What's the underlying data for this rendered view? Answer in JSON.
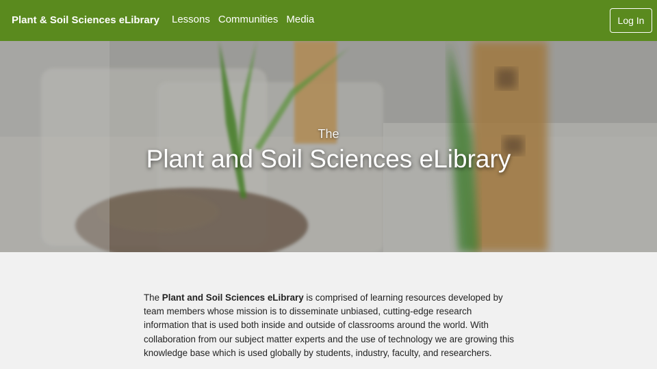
{
  "nav": {
    "brand": "Plant & Soil Sciences eLibrary",
    "links": [
      "Lessons",
      "Communities",
      "Media"
    ],
    "login_label": "Log In"
  },
  "hero": {
    "pretitle": "The",
    "title": "Plant and Soil Sciences eLibrary"
  },
  "intro": {
    "lead": "The ",
    "bold": "Plant and Soil Sciences eLibrary",
    "rest": " is comprised of learning resources developed by team members whose mission is to disseminate unbiased, cutting-edge research information that is used both inside and outside of classrooms around the world. With collaboration from our subject matter experts and the use of technology we are growing this knowledge base which is used globally by students, industry, faculty, and researchers."
  },
  "colors": {
    "navbar": "#5a8a1e",
    "page_bg": "#f1f1f1"
  }
}
